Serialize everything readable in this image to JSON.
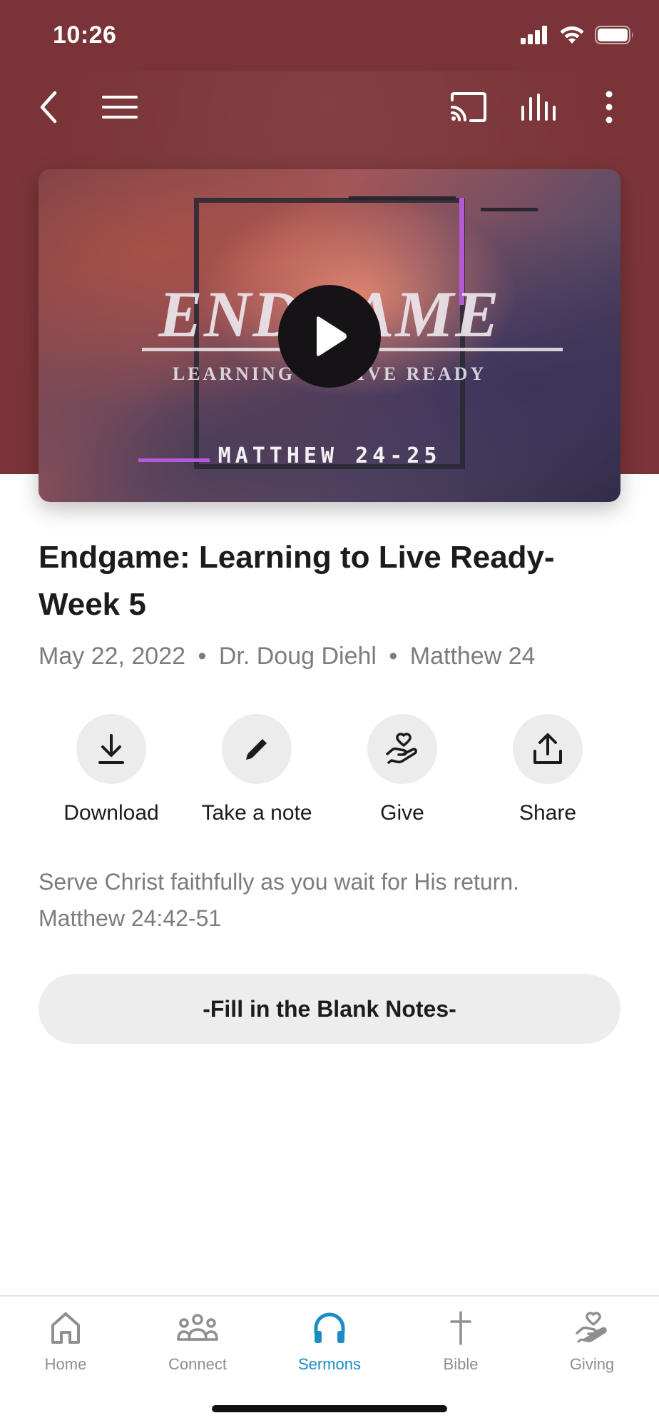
{
  "status_bar": {
    "time": "10:26"
  },
  "nav": {
    "back_icon": "chevron-left-icon",
    "menu_icon": "hamburger-icon",
    "cast_icon": "cast-icon",
    "audio_icon": "equalizer-icon",
    "more_icon": "more-vertical-icon"
  },
  "video": {
    "title_text": "ENDGAME",
    "subtitle_text": "LEARNING TO LIVE READY",
    "reference_text": "MATTHEW 24-25",
    "play_icon": "play-icon"
  },
  "sermon": {
    "title": "Endgame: Learning to Live Ready-Week 5",
    "date": "May 22, 2022",
    "speaker": "Dr. Doug Diehl",
    "scripture": "Matthew 24",
    "separator": "•",
    "description_line1": "Serve Christ faithfully as you wait for His return.",
    "description_line2": "Matthew 24:42-51"
  },
  "actions": [
    {
      "label": "Download",
      "icon": "download-icon"
    },
    {
      "label": "Take a note",
      "icon": "pencil-icon"
    },
    {
      "label": "Give",
      "icon": "hand-heart-icon"
    },
    {
      "label": "Share",
      "icon": "share-icon"
    }
  ],
  "notes_button": {
    "label": "-Fill in the Blank Notes-"
  },
  "tabs": [
    {
      "label": "Home",
      "icon": "home-icon",
      "active": false
    },
    {
      "label": "Connect",
      "icon": "people-icon",
      "active": false
    },
    {
      "label": "Sermons",
      "icon": "headphones-icon",
      "active": true
    },
    {
      "label": "Bible",
      "icon": "cross-icon",
      "active": false
    },
    {
      "label": "Giving",
      "icon": "hand-heart-icon",
      "active": false
    }
  ],
  "colors": {
    "header": "#7a3338",
    "active_tab": "#1a8cc7",
    "muted_text": "#7c7c80",
    "action_circle": "#ececed"
  }
}
